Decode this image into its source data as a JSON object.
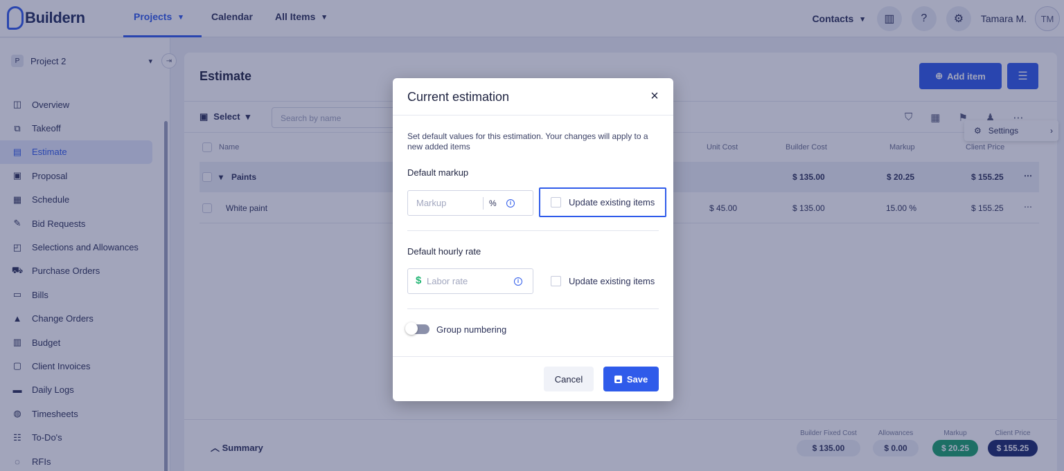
{
  "app": {
    "brand": "Buildern",
    "accent": "#2f5bea"
  },
  "topnav": {
    "tabs": [
      {
        "label": "Projects",
        "has_dropdown": true,
        "active": true
      },
      {
        "label": "Calendar",
        "has_dropdown": false,
        "active": false
      },
      {
        "label": "All Items",
        "has_dropdown": true,
        "active": false
      }
    ],
    "contacts": "Contacts",
    "user_name": "Tamara M.",
    "user_initials": "TM"
  },
  "sidebar": {
    "project": "Project 2",
    "project_initial": "P",
    "items": [
      {
        "label": "Overview",
        "icon": "overview-icon",
        "glyph": "◫"
      },
      {
        "label": "Takeoff",
        "icon": "takeoff-icon",
        "glyph": "⧉"
      },
      {
        "label": "Estimate",
        "icon": "estimate-icon",
        "glyph": "▤",
        "active": true
      },
      {
        "label": "Proposal",
        "icon": "proposal-icon",
        "glyph": "▣"
      },
      {
        "label": "Schedule",
        "icon": "schedule-icon",
        "glyph": "▦"
      },
      {
        "label": "Bid Requests",
        "icon": "bid-requests-icon",
        "glyph": "✎"
      },
      {
        "label": "Selections and Allowances",
        "icon": "selections-icon",
        "glyph": "◰"
      },
      {
        "label": "Purchase Orders",
        "icon": "purchase-orders-icon",
        "glyph": "⛟"
      },
      {
        "label": "Bills",
        "icon": "bills-icon",
        "glyph": "▭"
      },
      {
        "label": "Change Orders",
        "icon": "change-orders-icon",
        "glyph": "▲"
      },
      {
        "label": "Budget",
        "icon": "budget-icon",
        "glyph": "▥"
      },
      {
        "label": "Client Invoices",
        "icon": "client-invoices-icon",
        "glyph": "▢"
      },
      {
        "label": "Daily Logs",
        "icon": "daily-logs-icon",
        "glyph": "▬"
      },
      {
        "label": "Timesheets",
        "icon": "timesheets-icon",
        "glyph": "◍"
      },
      {
        "label": "To-Do's",
        "icon": "todos-icon",
        "glyph": "☷"
      },
      {
        "label": "RFIs",
        "icon": "rfis-icon",
        "glyph": "◌"
      }
    ]
  },
  "main": {
    "title": "Estimate",
    "add_item_label": "Add item",
    "select_label": "Select",
    "search_placeholder": "Search by name",
    "settings_label": "Settings",
    "columns": {
      "name": "Name",
      "unit_cost": "Unit Cost",
      "builder_cost": "Builder Cost",
      "markup": "Markup",
      "client_price": "Client Price"
    },
    "group_row": {
      "name": "Paints",
      "builder_cost": "$ 135.00",
      "markup": "$ 20.25",
      "client_price": "$ 155.25"
    },
    "item_row": {
      "name": "White paint",
      "unit_cost": "$ 45.00",
      "builder_cost": "$ 135.00",
      "markup": "15.00 %",
      "client_price": "$ 155.25"
    },
    "summary": {
      "label": "Summary",
      "builder_fixed_cost_caption": "Builder Fixed Cost",
      "builder_fixed_cost": "$ 135.00",
      "allowances_caption": "Allowances",
      "allowances": "$ 0.00",
      "markup_caption": "Markup",
      "markup": "$ 20.25",
      "client_price_caption": "Client Price",
      "client_price": "$ 155.25"
    }
  },
  "modal": {
    "title": "Current estimation",
    "description": "Set default values for this estimation. Your changes will apply to a new added items",
    "markup_section": "Default markup",
    "markup_placeholder": "Markup",
    "markup_unit": "%",
    "markup_update_label": "Update existing items",
    "hourly_section": "Default hourly rate",
    "labor_placeholder": "Labor rate",
    "labor_currency": "$",
    "hourly_update_label": "Update existing items",
    "group_numbering_label": "Group numbering",
    "group_numbering_on": false,
    "cancel_label": "Cancel",
    "save_label": "Save"
  }
}
